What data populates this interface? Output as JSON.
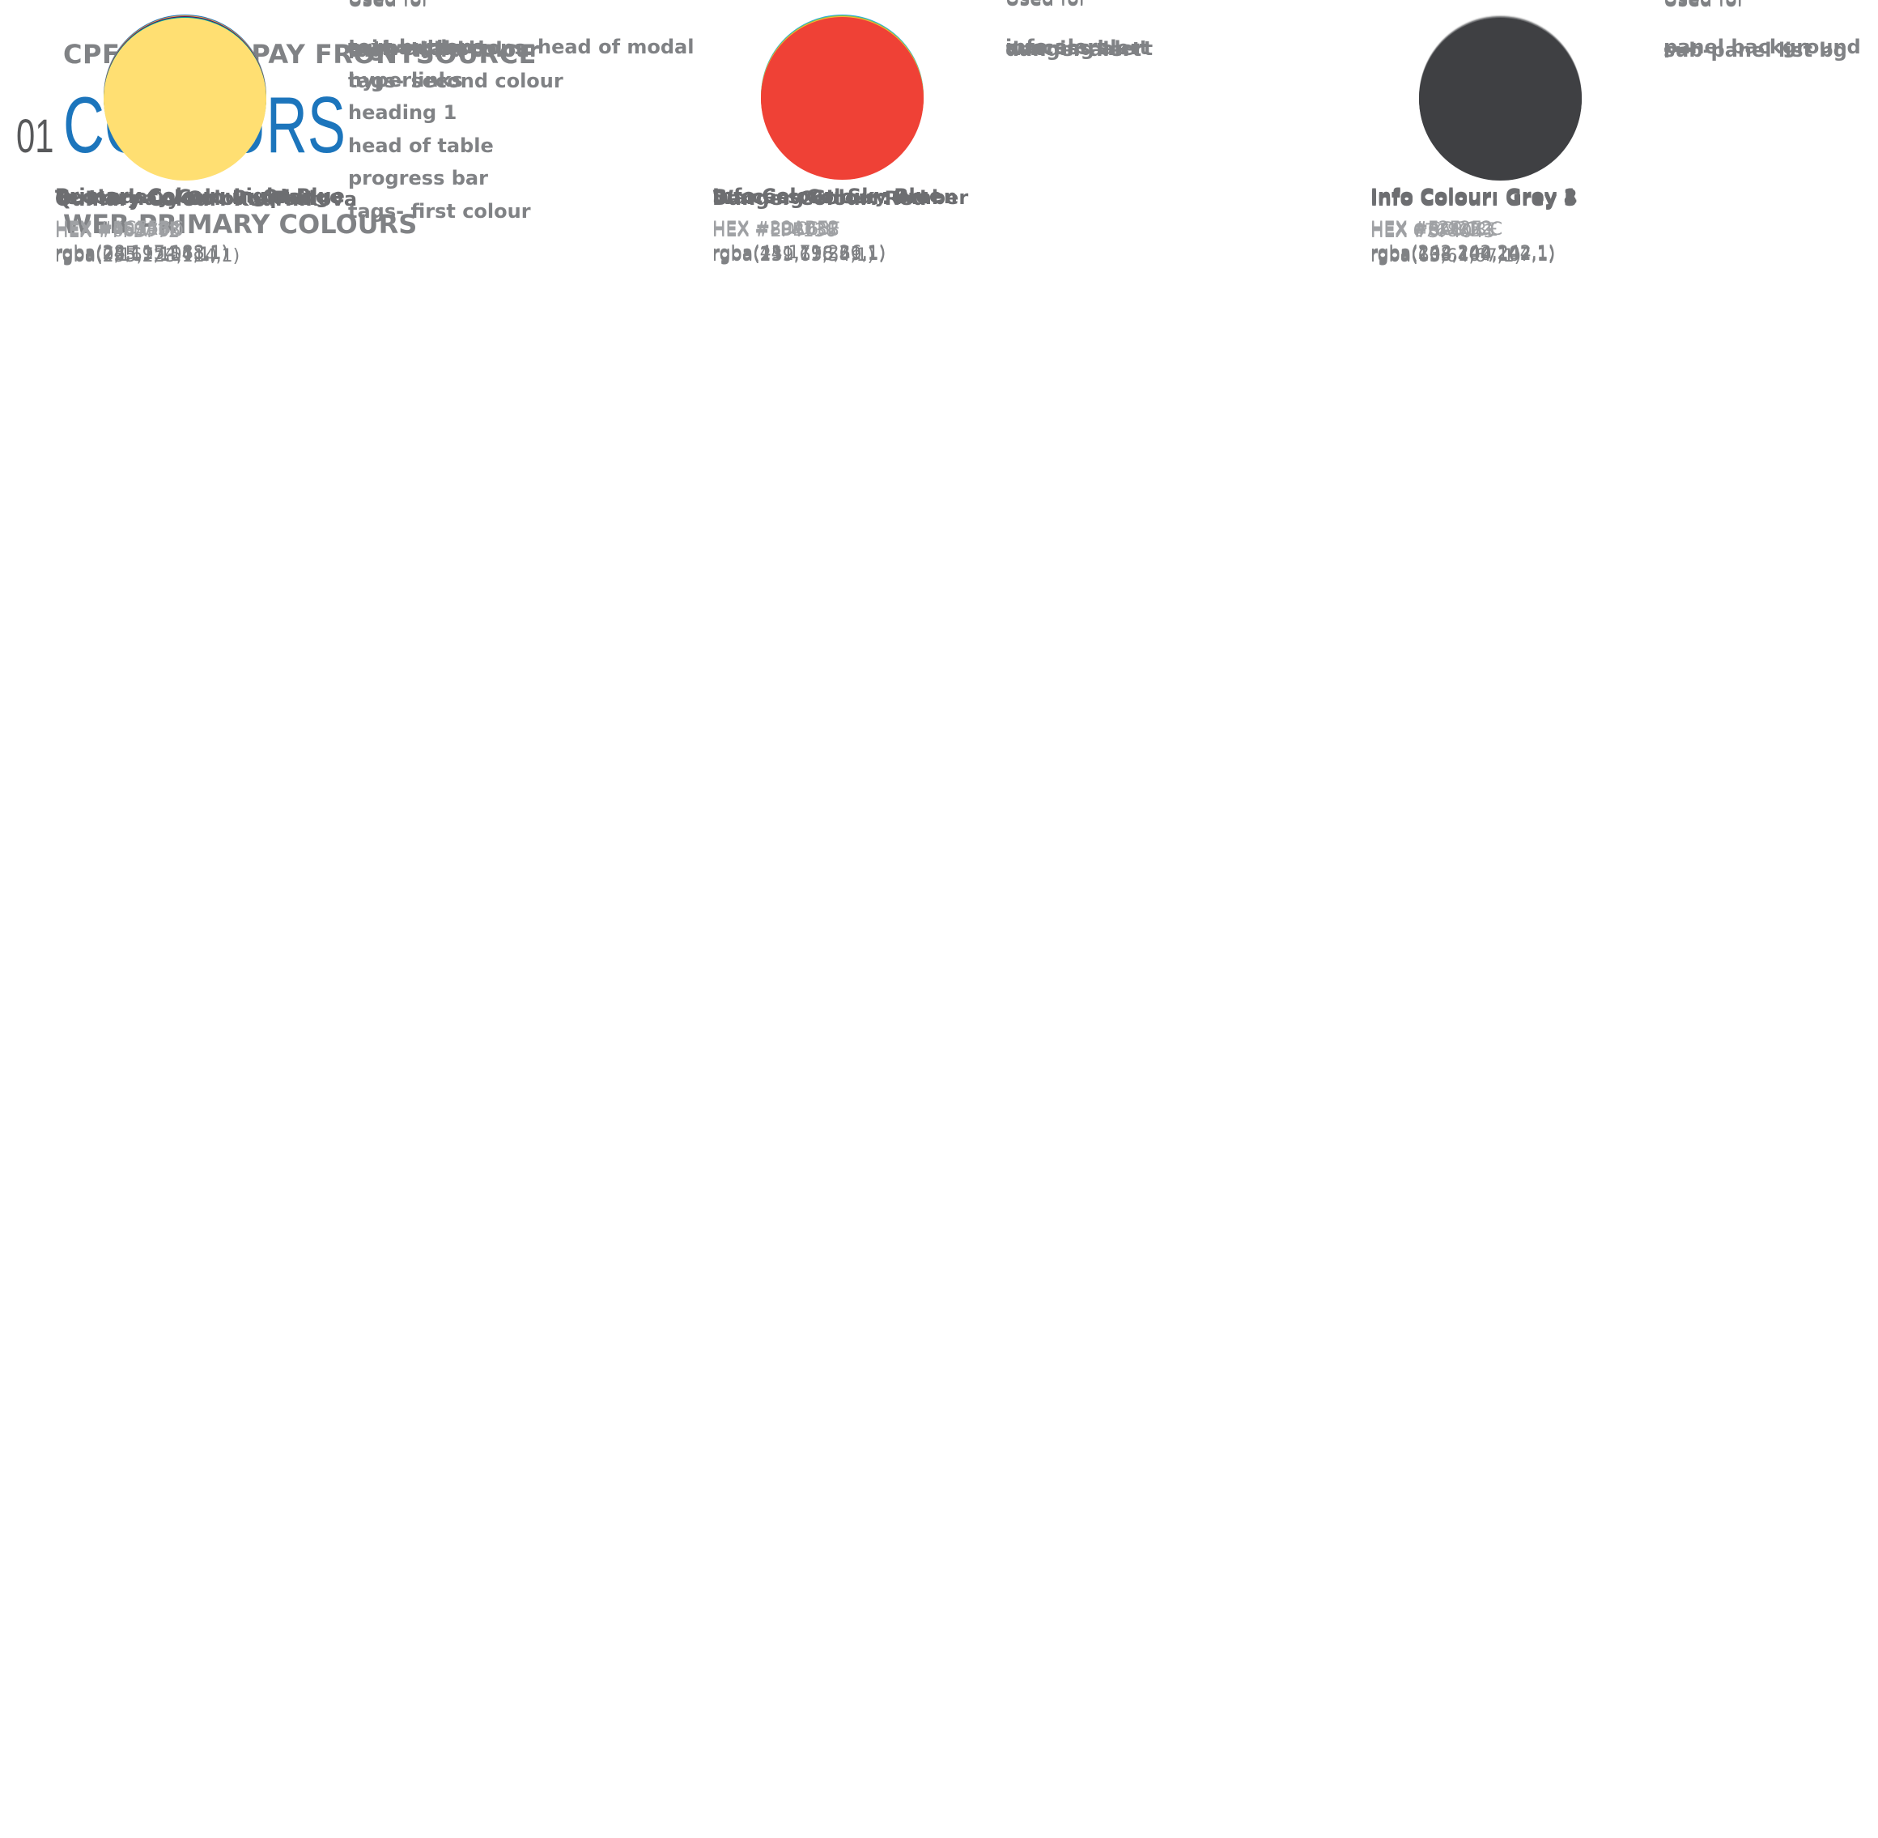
{
  "brand": "CPF - CLOUDPAY FRONTSOURCE",
  "heading": {
    "number": "01",
    "title": "COLOURS"
  },
  "section_title": "WEB PRIMARY COLOURS",
  "used_for_label": "Used for",
  "colours": [
    {
      "name": "Primary Colour: Light Blue",
      "hex_label": "HEX  #1C75BC",
      "rgba": "rgba(28,117,188,1)",
      "color": "#1C75BC",
      "uses": [
        "text buttons",
        "hyperlinks",
        "heading 1",
        "head of table",
        "progress bar",
        "tags- first colour"
      ],
      "uses_col2": [
        "head of modal"
      ]
    },
    {
      "name": "Info Colour: Sky Blue",
      "hex_label": "HEX  #29ABE2",
      "rgba": "rgba(41,171,226,1)",
      "color": "#29ABE2",
      "uses": [
        "info alert"
      ]
    },
    {
      "name": "Info Colour: Grey 1",
      "hex_label": "HEX  #F2F2F2",
      "rgba": "rgba(242,242,242,1)",
      "color": "#F2F2F2",
      "uses": [
        "panel background"
      ]
    },
    {
      "name": "Secondary Colour: Orange",
      "hex_label": "HEX  #F59A3F",
      "rgba": "rgba(245,154,63,1)",
      "color": "#F59A3F",
      "uses": [
        "primary buttons",
        "tags- second colour"
      ]
    },
    {
      "name": "Success Colour: Green",
      "hex_label": "HEX  #8DC63F",
      "rgba": "rgba(141,198,61,1)",
      "color": "#8DC63F",
      "uses": [
        "success alert"
      ]
    },
    {
      "name": "Info Colour: Grey 2",
      "hex_label": "HEX  #CCCCCC",
      "rgba": "rgba(204,204,204,1)",
      "color": "#CCCCCC",
      "uses": [
        "----"
      ]
    },
    {
      "name": "Tertiary Colour: Purple",
      "hex_label": "HEX  #481368",
      "rgba": "rgba(72,19,104,1)",
      "color": "#481368",
      "uses": [
        "active tabs"
      ]
    },
    {
      "name": "Warning Colour: Amber",
      "hex_label": "HEX  #FBB03B",
      "rgba": "rgba(251,176,59,1)",
      "color": "#FBB03B",
      "uses": [
        "warning alert"
      ]
    },
    {
      "name": "Info Colour: Grey 3",
      "hex_label": "HEX  #8A8C8E",
      "rgba": "rgba(138,140,142,1)",
      "color": "#8A8C8E",
      "uses": [
        "----"
      ]
    },
    {
      "name": "Quaternary Colour: Teal",
      "hex_label": "HEX  #00A79D",
      "rgba": "rgba(0,167,157,1)",
      "color": "#00A79D",
      "uses": [
        "tags- third colour"
      ]
    },
    {
      "name": "Danger Colour: Red",
      "hex_label": "HEX  #EF4136",
      "rgba": "rgba(239,65,54,1)",
      "color": "#EF4136",
      "uses": [
        "danger alert"
      ]
    },
    {
      "name": "Info Colour: Grey 4",
      "hex_label": "HEX  67686B",
      "rgba": "rgba(103,104,107,1)",
      "color": "#67686B",
      "uses": [
        "----"
      ]
    },
    {
      "name": "Quinary Colour: Kournikova",
      "hex_label": "HEX  #FFDF72",
      "rgba": "rgba(255,223,114,1)",
      "color": "#FFDF72",
      "uses": [
        "tags- third colour"
      ]
    },
    {
      "name": "Info Colour: Grey 5",
      "hex_label": "HEX  #3F4043",
      "rgba": "rgba(63,64,67,1)",
      "color": "#3F4043",
      "uses": [
        "sub-panel list bg"
      ]
    }
  ]
}
